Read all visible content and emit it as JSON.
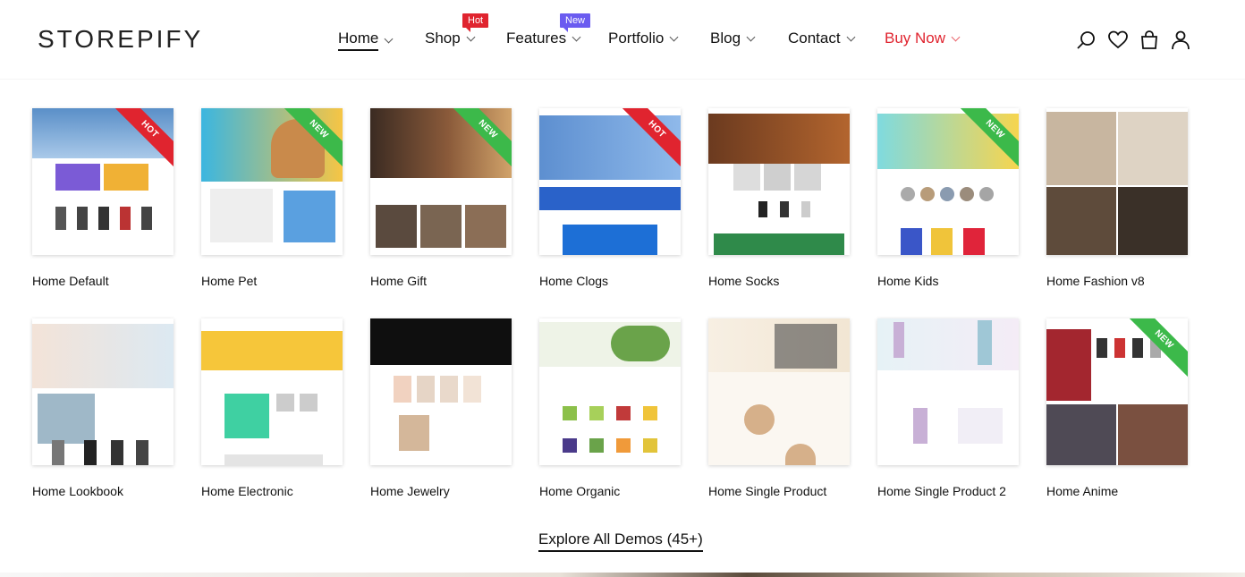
{
  "header": {
    "logo": "STOREPIFY",
    "nav": [
      {
        "label": "Home",
        "active": true,
        "badge": null
      },
      {
        "label": "Shop",
        "active": false,
        "badge": "Hot"
      },
      {
        "label": "Features",
        "active": false,
        "badge": "New"
      },
      {
        "label": "Portfolio",
        "active": false,
        "badge": null
      },
      {
        "label": "Blog",
        "active": false,
        "badge": null
      },
      {
        "label": "Contact",
        "active": false,
        "badge": null
      },
      {
        "label": "Buy Now",
        "active": false,
        "badge": null
      }
    ],
    "icons": [
      "search-icon",
      "heart-icon",
      "bag-icon",
      "user-icon"
    ]
  },
  "colors": {
    "accent_red": "#e0242f",
    "badge_purple": "#6b5cf0",
    "ribbon_green": "#3cb94a"
  },
  "demos": [
    {
      "title": "Home Default",
      "ribbon": "HOT"
    },
    {
      "title": "Home Pet",
      "ribbon": "NEW"
    },
    {
      "title": "Home Gift",
      "ribbon": "NEW"
    },
    {
      "title": "Home Clogs",
      "ribbon": "HOT"
    },
    {
      "title": "Home Socks",
      "ribbon": null
    },
    {
      "title": "Home Kids",
      "ribbon": "NEW"
    },
    {
      "title": "Home Fashion v8",
      "ribbon": null
    },
    {
      "title": "Home Lookbook",
      "ribbon": null
    },
    {
      "title": "Home Electronic",
      "ribbon": null
    },
    {
      "title": "Home Jewelry",
      "ribbon": null
    },
    {
      "title": "Home Organic",
      "ribbon": null
    },
    {
      "title": "Home Single Product",
      "ribbon": null
    },
    {
      "title": "Home Single Product 2",
      "ribbon": null
    },
    {
      "title": "Home Anime",
      "ribbon": "NEW"
    }
  ],
  "explore_label": "Explore All Demos (45+)"
}
